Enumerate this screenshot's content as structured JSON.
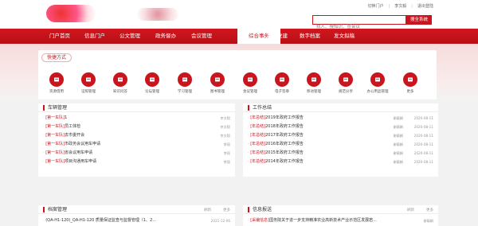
{
  "header": {
    "top_links": [
      "切换门户",
      "李文毅",
      "退出登陆"
    ],
    "search_placeholder": "找人、搜知识、查会议",
    "search_button": "搜全系统"
  },
  "nav": {
    "items": [
      "门户首页",
      "信息门户",
      "公文管理",
      "政务督办",
      "会议管理",
      "综合事务",
      "智慧党建",
      "数字档案",
      "发文拟稿"
    ],
    "active_index": 5
  },
  "quick": {
    "title": "快捷方式",
    "items": [
      {
        "label": "资源借用",
        "icon": "bag-icon"
      },
      {
        "label": "证照管理",
        "icon": "certificate-icon"
      },
      {
        "label": "知识问答",
        "icon": "qa-icon"
      },
      {
        "label": "论坛管理",
        "icon": "monitor-icon"
      },
      {
        "label": "学习管理",
        "icon": "study-icon"
      },
      {
        "label": "图书管理",
        "icon": "book-icon"
      },
      {
        "label": "会议管理",
        "icon": "meeting-icon"
      },
      {
        "label": "电子签章",
        "icon": "seal-icon"
      },
      {
        "label": "移动管理",
        "icon": "mobile-icon"
      },
      {
        "label": "规范分享",
        "icon": "share-icon"
      },
      {
        "label": "办公用品管理",
        "icon": "supplies-icon"
      },
      {
        "label": "更多",
        "icon": "more-icon"
      }
    ]
  },
  "vehicle": {
    "title": "车辆管理",
    "more": "更多",
    "rows": [
      {
        "tag": "[第一车队]",
        "title": "1",
        "who": "李文毅",
        "date": ""
      },
      {
        "tag": "[第一车队]",
        "title": "员工体检",
        "who": "李文毅",
        "date": ""
      },
      {
        "tag": "[第一车队]",
        "title": "去市委开会",
        "who": "李文毅",
        "date": ""
      },
      {
        "tag": "[第一车队]",
        "title": "市政务会议用车申请",
        "who": "李丽",
        "date": ""
      },
      {
        "tag": "[第一车队]",
        "title": "省会议用车申请",
        "who": "李丽",
        "date": ""
      },
      {
        "tag": "[第一车队]",
        "title": "项目沟通用车申请",
        "who": "李丽",
        "date": ""
      }
    ]
  },
  "work": {
    "title": "工作总结",
    "more": "更多",
    "rows": [
      {
        "tag": "[年总结]",
        "title": "2019年政府工作报告",
        "who": "谢毓娟",
        "date": "2020-08-11"
      },
      {
        "tag": "[年总结]",
        "title": "2018年政府工作报告",
        "who": "谢毓娟",
        "date": "2020-08-11"
      },
      {
        "tag": "[年总结]",
        "title": "2017年政府工作报告",
        "who": "谢毓娟",
        "date": "2020-08-11"
      },
      {
        "tag": "[年总结]",
        "title": "2016年政府工作报告",
        "who": "谢毓娟",
        "date": "2020-08-11"
      },
      {
        "tag": "[年总结]",
        "title": "2015年政府工作报告",
        "who": "谢毓娟",
        "date": "2020-08-11"
      },
      {
        "tag": "[年总结]",
        "title": "2014年政府工作报告",
        "who": "谢毓娟",
        "date": "2020-08-11"
      }
    ]
  },
  "archive": {
    "title": "档案管理",
    "refresh": "刷新",
    "more": "更多",
    "rows": [
      {
        "tag": "",
        "title": "(QA-H1-120)_QA-H1-120 质量保证监查与监督管理（1、2...",
        "who": "",
        "date": "2021-12-06"
      }
    ]
  },
  "info": {
    "title": "信息报送",
    "refresh": "刷新",
    "more": "更多",
    "rows": [
      {
        "tag": "[采编信息]",
        "title": "国务院关于进一步支持精准农业高新技术产业示范区发展若...",
        "who": "谢毓娟",
        "date": ""
      }
    ]
  },
  "colors": {
    "brand_red": "#c9151e"
  }
}
